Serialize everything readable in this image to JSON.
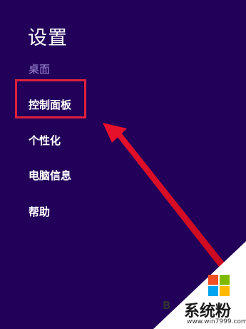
{
  "settings": {
    "title": "设置",
    "subtitle": "桌面",
    "items": [
      {
        "label": "控制面板"
      },
      {
        "label": "个性化"
      },
      {
        "label": "电脑信息"
      },
      {
        "label": "帮助"
      }
    ]
  },
  "watermark": {
    "brand": "系统粉",
    "url": "www.win7999.com",
    "letter": "B"
  },
  "colors": {
    "background": "#22005a",
    "highlight": "#e0203a",
    "subtitle": "#9e8cd6"
  }
}
